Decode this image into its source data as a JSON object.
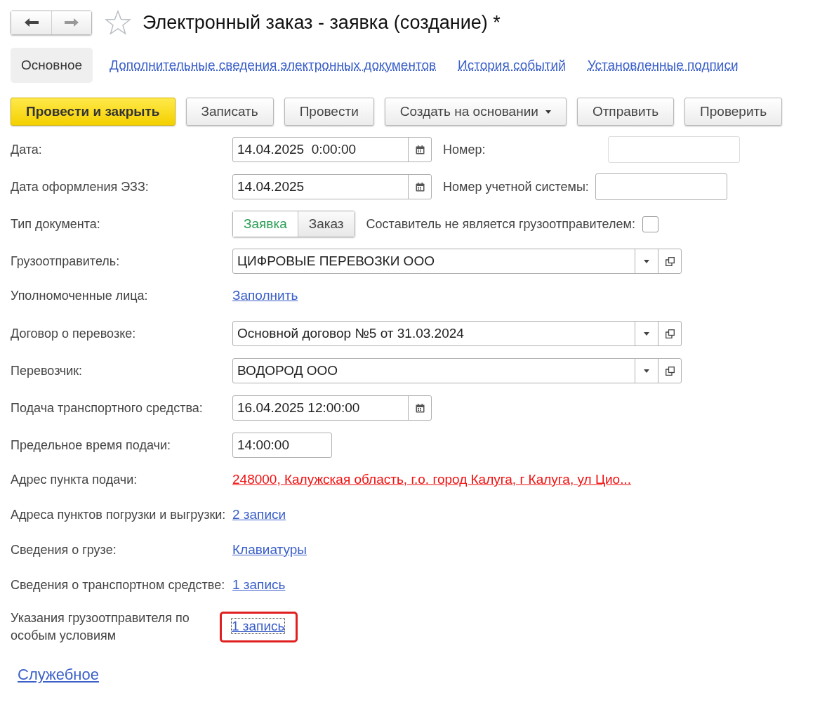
{
  "window": {
    "title": "Электронный заказ - заявка (создание) *",
    "favorite": false
  },
  "tabs": [
    {
      "label": "Основное",
      "selected": true
    },
    {
      "label": "Дополнительные сведения электронных документов",
      "selected": false
    },
    {
      "label": "История событий",
      "selected": false
    },
    {
      "label": "Установленные подписи",
      "selected": false
    }
  ],
  "toolbar": [
    {
      "label": "Провести и закрыть",
      "kind": "primary"
    },
    {
      "label": "Записать",
      "kind": "plain"
    },
    {
      "label": "Провести",
      "kind": "plain"
    },
    {
      "label": "Создать на основании",
      "kind": "menu"
    },
    {
      "label": "Отправить",
      "kind": "plain"
    },
    {
      "label": "Проверить",
      "kind": "plain"
    }
  ],
  "rows": [
    {
      "label": "Дата:",
      "kind": "date",
      "value": "14.04.2025  0:00:00",
      "side": {
        "label": "Номер:",
        "kind": "input",
        "disabled": true
      }
    },
    {
      "label": "Дата оформления ЭЗЗ:",
      "kind": "date",
      "value": "14.04.2025",
      "side": {
        "label": "Номер учетной системы:",
        "kind": "input",
        "disabled": false
      }
    },
    {
      "label": "Тип документа:",
      "kind": "switch",
      "options": [
        {
          "label": "Заявка",
          "selected": true
        },
        {
          "label": "Заказ",
          "selected": false
        }
      ],
      "side": {
        "label": "Составитель не является грузоотправителем:",
        "kind": "checkbox",
        "checked": false
      }
    },
    {
      "label": "Грузоотправитель:",
      "kind": "select",
      "value": "ЦИФРОВЫЕ ПЕРЕВОЗКИ ООО"
    },
    {
      "label": "Уполномоченные лица:",
      "kind": "link",
      "value": "Заполнить",
      "warning": false,
      "highlighted": false
    },
    {
      "label": "Договор о перевозке:",
      "kind": "select",
      "value": "Основной договор №5 от 31.03.2024"
    },
    {
      "label": "Перевозчик:",
      "kind": "select",
      "value": "ВОДОРОД ООО"
    },
    {
      "label": "Подача транспортного средства:",
      "kind": "date",
      "value": "16.04.2025 12:00:00"
    },
    {
      "label": "Предельное время подачи:",
      "kind": "time",
      "value": "14:00:00"
    },
    {
      "label": "Адрес пункта подачи:",
      "kind": "link",
      "value": "248000, Калужская область, г.о. город Калуга, г Калуга, ул Цио...",
      "warning": true,
      "highlighted": false
    },
    {
      "label": "Адреса пунктов погрузки и выгрузки:",
      "kind": "link",
      "value": "2 записи",
      "warning": false,
      "highlighted": false
    },
    {
      "label": "Сведения о грузе:",
      "kind": "link",
      "value": "Клавиатуры",
      "warning": false,
      "highlighted": false
    },
    {
      "label": "Сведения о транспортном средстве:",
      "kind": "link",
      "value": "1 запись",
      "warning": false,
      "highlighted": false
    },
    {
      "label": "Указания грузоотправителя по особым условиям",
      "kind": "link",
      "value": "1 запись",
      "warning": false,
      "highlighted": true
    }
  ],
  "footer_link": "Служебное"
}
